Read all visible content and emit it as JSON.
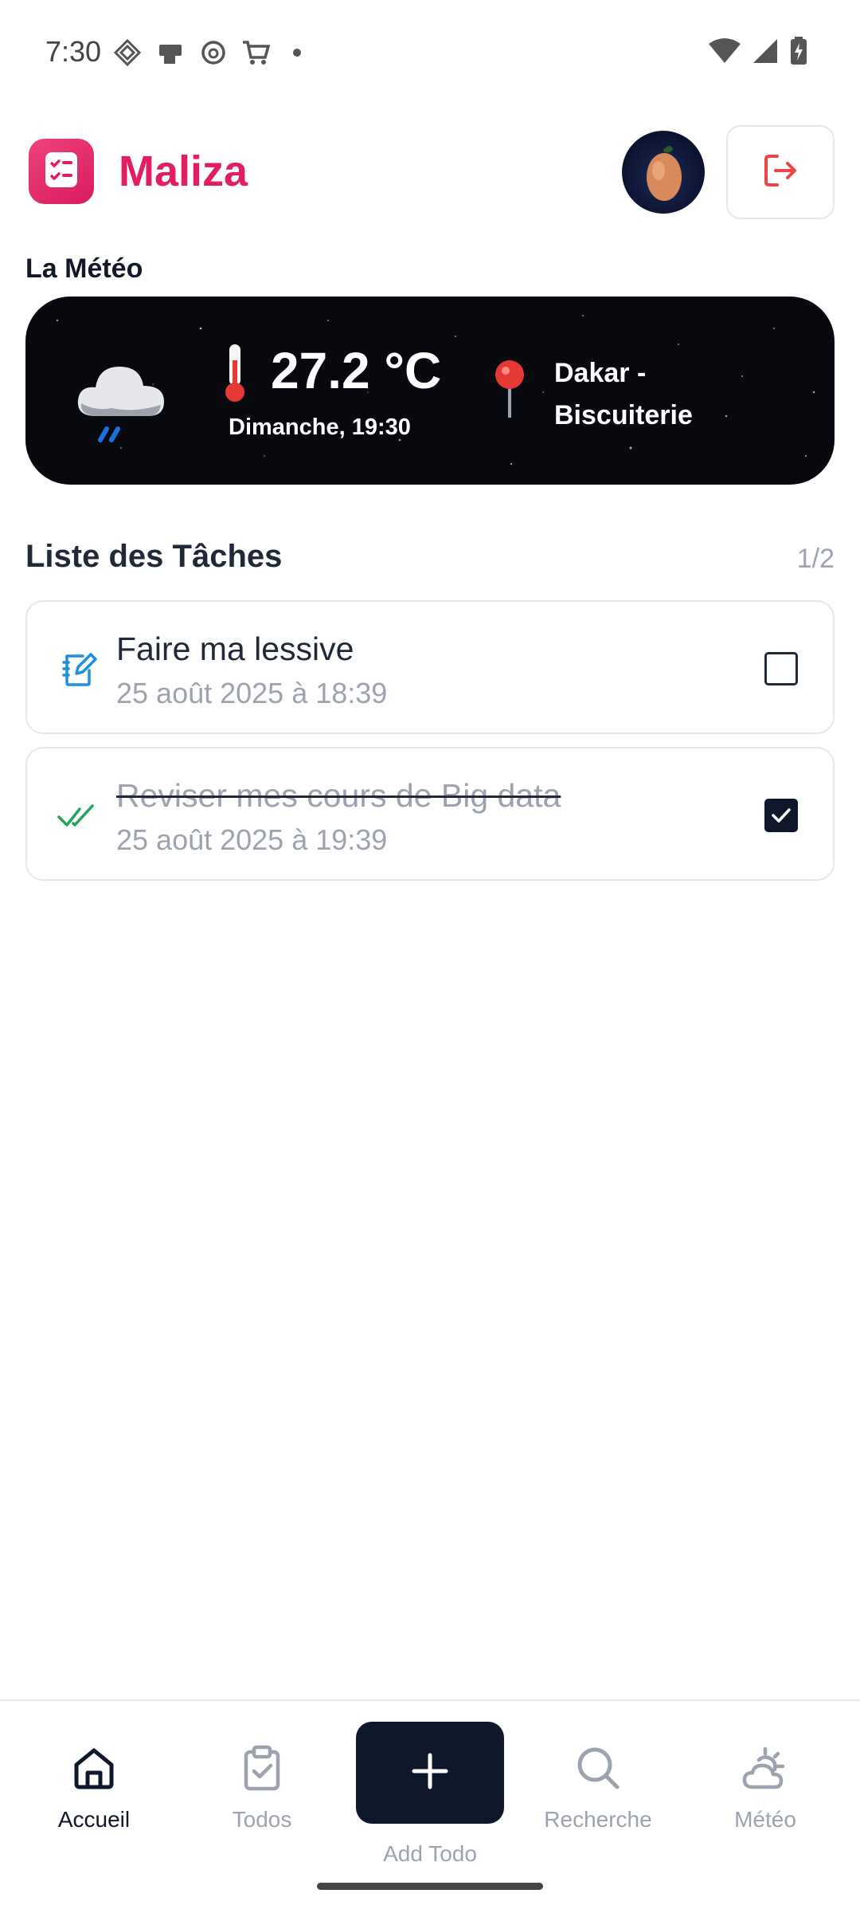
{
  "status_bar": {
    "time": "7:30",
    "left_icons": [
      "grid-notification-icon",
      "phone-card-icon",
      "threads-icon",
      "cart-icon",
      "dot-icon"
    ],
    "right_icons": [
      "wifi-icon",
      "cell-signal-icon",
      "battery-charging-icon"
    ]
  },
  "header": {
    "app_name": "Maliza",
    "logo_icon": "checklist-icon",
    "avatar_icon": "mango-avatar",
    "logout_icon": "logout-icon",
    "accent_color": "#e11d63"
  },
  "weather": {
    "section_title": "La Météo",
    "condition_icon": "rain-cloud-icon",
    "temperature": "27.2 °C",
    "date_time": "Dimanche, 19:30",
    "location_line1": "Dakar -",
    "location_line2": "Biscuiterie"
  },
  "tasks": {
    "title": "Liste des Tâches",
    "count": "1/2",
    "items": [
      {
        "title": "Faire ma lessive",
        "date": "25 août 2025 à 18:39",
        "done": false,
        "icon": "edit-note-icon"
      },
      {
        "title": "Reviser mes cours de Big data",
        "date": "25 août 2025 à 19:39",
        "done": true,
        "icon": "double-check-icon"
      }
    ]
  },
  "bottom_nav": {
    "items": [
      {
        "label": "Accueil",
        "icon": "home-icon",
        "active": true
      },
      {
        "label": "Todos",
        "icon": "clipboard-check-icon",
        "active": false
      },
      {
        "label": "Add Todo",
        "icon": "plus-icon",
        "active": false
      },
      {
        "label": "Recherche",
        "icon": "search-icon",
        "active": false
      },
      {
        "label": "Météo",
        "icon": "cloud-sun-icon",
        "active": false
      }
    ]
  }
}
